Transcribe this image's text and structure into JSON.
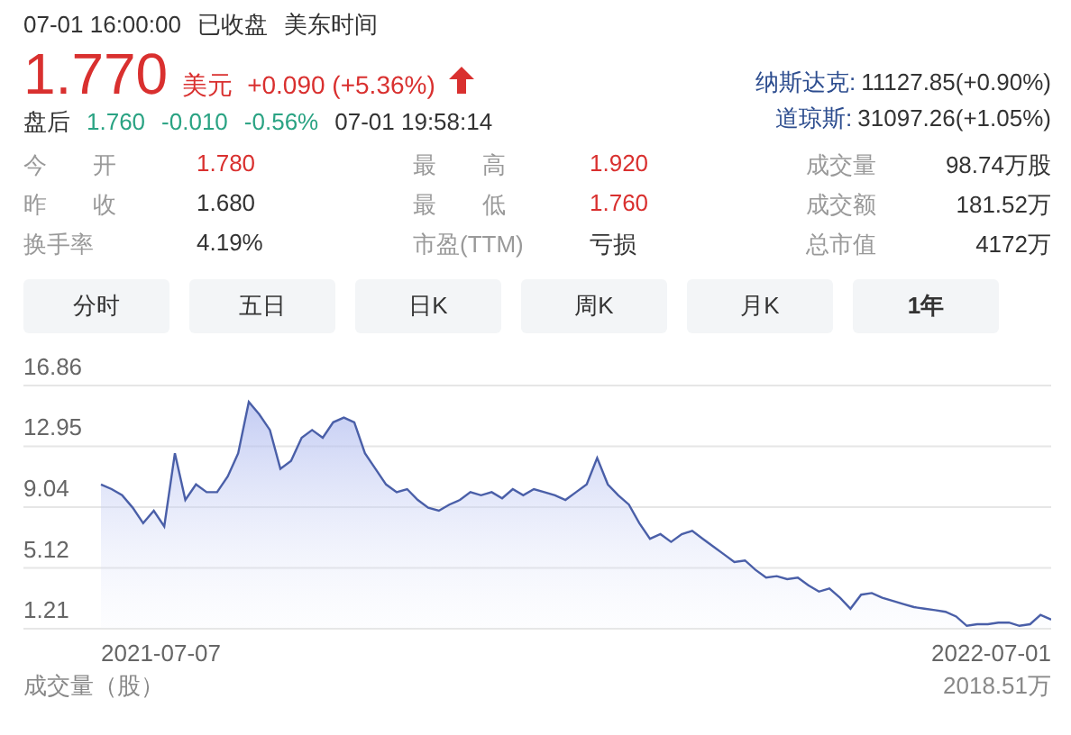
{
  "header": {
    "datetime": "07-01 16:00:00",
    "status": "已收盘",
    "timezone": "美东时间"
  },
  "quote": {
    "price": "1.770",
    "currency": "美元",
    "change": "+0.090 (+5.36%)",
    "color": "#d9302f"
  },
  "after_hours": {
    "label": "盘后",
    "price": "1.760",
    "change": "-0.010",
    "percent": "-0.56%",
    "time": "07-01 19:58:14",
    "color": "#2aa383"
  },
  "indices": [
    {
      "name": "纳斯达克:",
      "value": "11127.85(+0.90%)"
    },
    {
      "name": "道琼斯:",
      "value": "31097.26(+1.05%)"
    }
  ],
  "stats": [
    {
      "label": "今 开",
      "value": "1.780",
      "color": "#d9302f"
    },
    {
      "label": "最 高",
      "value": "1.920",
      "color": "#d9302f"
    },
    {
      "label": "成交量",
      "value": "98.74万股",
      "color": "#333333"
    },
    {
      "label": "昨 收",
      "value": "1.680",
      "color": "#333333"
    },
    {
      "label": "最 低",
      "value": "1.760",
      "color": "#d9302f"
    },
    {
      "label": "成交额",
      "value": "181.52万",
      "color": "#333333"
    },
    {
      "label": "换手率",
      "value": "4.19%",
      "color": "#333333"
    },
    {
      "label": "市盈(TTM)",
      "value": "亏损",
      "color": "#333333"
    },
    {
      "label": "总市值",
      "value": "4172万",
      "color": "#333333"
    }
  ],
  "tabs": [
    {
      "label": "分时",
      "selected": false
    },
    {
      "label": "五日",
      "selected": false
    },
    {
      "label": "日K",
      "selected": false
    },
    {
      "label": "周K",
      "selected": false
    },
    {
      "label": "月K",
      "selected": false
    },
    {
      "label": "1年",
      "selected": true
    }
  ],
  "chart": {
    "date_labels": [
      "2021-07-07",
      "2022-07-01"
    ],
    "chart_data": {
      "type": "area",
      "grid": true,
      "ylim": [
        1.21,
        16.86
      ],
      "yticks": [
        16.86,
        12.95,
        9.04,
        5.12,
        1.21
      ],
      "series": [
        {
          "color": "#4a5fa8",
          "values": [
            10.5,
            10.2,
            9.8,
            9,
            8,
            8.8,
            7.8,
            12.5,
            9.5,
            10.5,
            10,
            10,
            11,
            12.5,
            15.8,
            15,
            14,
            11.5,
            12,
            13.5,
            14,
            13.5,
            14.5,
            14.8,
            14.5,
            12.5,
            11.5,
            10.5,
            10,
            10.2,
            9.5,
            9,
            8.8,
            9.2,
            9.5,
            10,
            9.8,
            10,
            9.6,
            10.2,
            9.8,
            10.2,
            10,
            9.8,
            9.5,
            10,
            10.5,
            12.2,
            10.5,
            9.8,
            9.2,
            8,
            7,
            7.3,
            6.8,
            7.3,
            7.5,
            7,
            6.5,
            6,
            5.5,
            5.6,
            5,
            4.5,
            4.6,
            4.4,
            4.5,
            4,
            3.6,
            3.8,
            3.2,
            2.5,
            3.4,
            3.5,
            3.2,
            3,
            2.8,
            2.6,
            2.5,
            2.4,
            2.3,
            2,
            1.4,
            1.5,
            1.5,
            1.6,
            1.6,
            1.4,
            1.5,
            2.1,
            1.8
          ]
        }
      ]
    }
  },
  "volume": {
    "label": "成交量（股）",
    "value": "2018.51万"
  }
}
